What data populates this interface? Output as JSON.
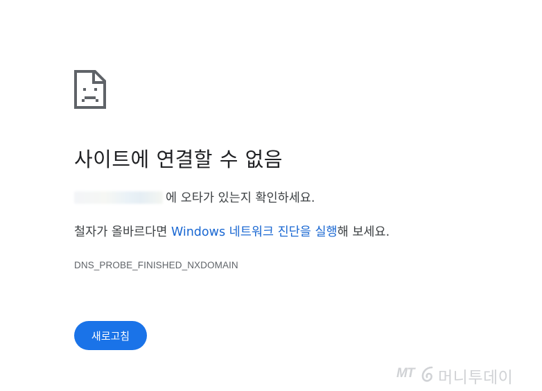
{
  "error_page": {
    "icon": "sad-document-icon",
    "title": "사이트에 연결할 수 없음",
    "typo_message": "에 오타가 있는지 확인하세요.",
    "diagnose_prefix": "철자가 올바르다면 ",
    "diagnose_link": "Windows 네트워크 진단을 실행",
    "diagnose_suffix": "해 보세요.",
    "error_code": "DNS_PROBE_FINISHED_NXDOMAIN",
    "reload_label": "새로고침",
    "accent_color": "#1a73e8",
    "link_color": "#1967d2"
  },
  "watermark": {
    "brand_abbr": "MT",
    "brand_name": "머니투데이",
    "icon": "swirl-logo-icon"
  }
}
